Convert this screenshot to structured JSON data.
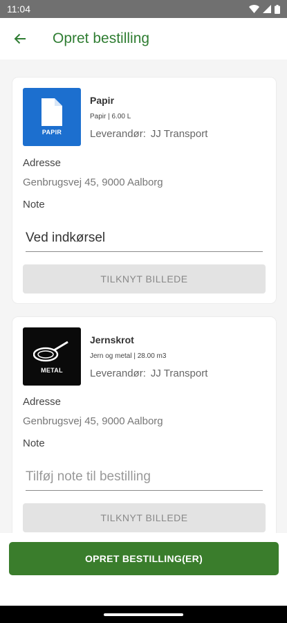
{
  "status_bar": {
    "time": "11:04"
  },
  "app_bar": {
    "title": "Opret bestilling"
  },
  "orders": [
    {
      "icon": "paper-bin-icon",
      "icon_label": "PAPIR",
      "title": "Papir",
      "subtitle": "Papir | 6.00 L",
      "supplier_label": "Leverandør:",
      "supplier": "JJ Transport",
      "address_label": "Adresse",
      "address": "Genbrugsvej 45, 9000 Aalborg",
      "note_label": "Note",
      "note_value": "Ved indkørsel",
      "note_placeholder": "Tilføj note til bestilling",
      "attach_label": "TILKNYT BILLEDE"
    },
    {
      "icon": "frying-pan-icon",
      "icon_label": "METAL",
      "title": "Jernskrot",
      "subtitle": "Jern og metal | 28.00 m3",
      "supplier_label": "Leverandør:",
      "supplier": "JJ Transport",
      "address_label": "Adresse",
      "address": "Genbrugsvej 45, 9000 Aalborg",
      "note_label": "Note",
      "note_value": "",
      "note_placeholder": "Tilføj note til bestilling",
      "attach_label": "TILKNYT BILLEDE"
    }
  ],
  "footer": {
    "create_label": "OPRET BESTILLING(ER)"
  },
  "colors": {
    "brand_green": "#2f7d32",
    "button_green": "#3a7d2c",
    "paper_blue": "#1c6fcf"
  }
}
